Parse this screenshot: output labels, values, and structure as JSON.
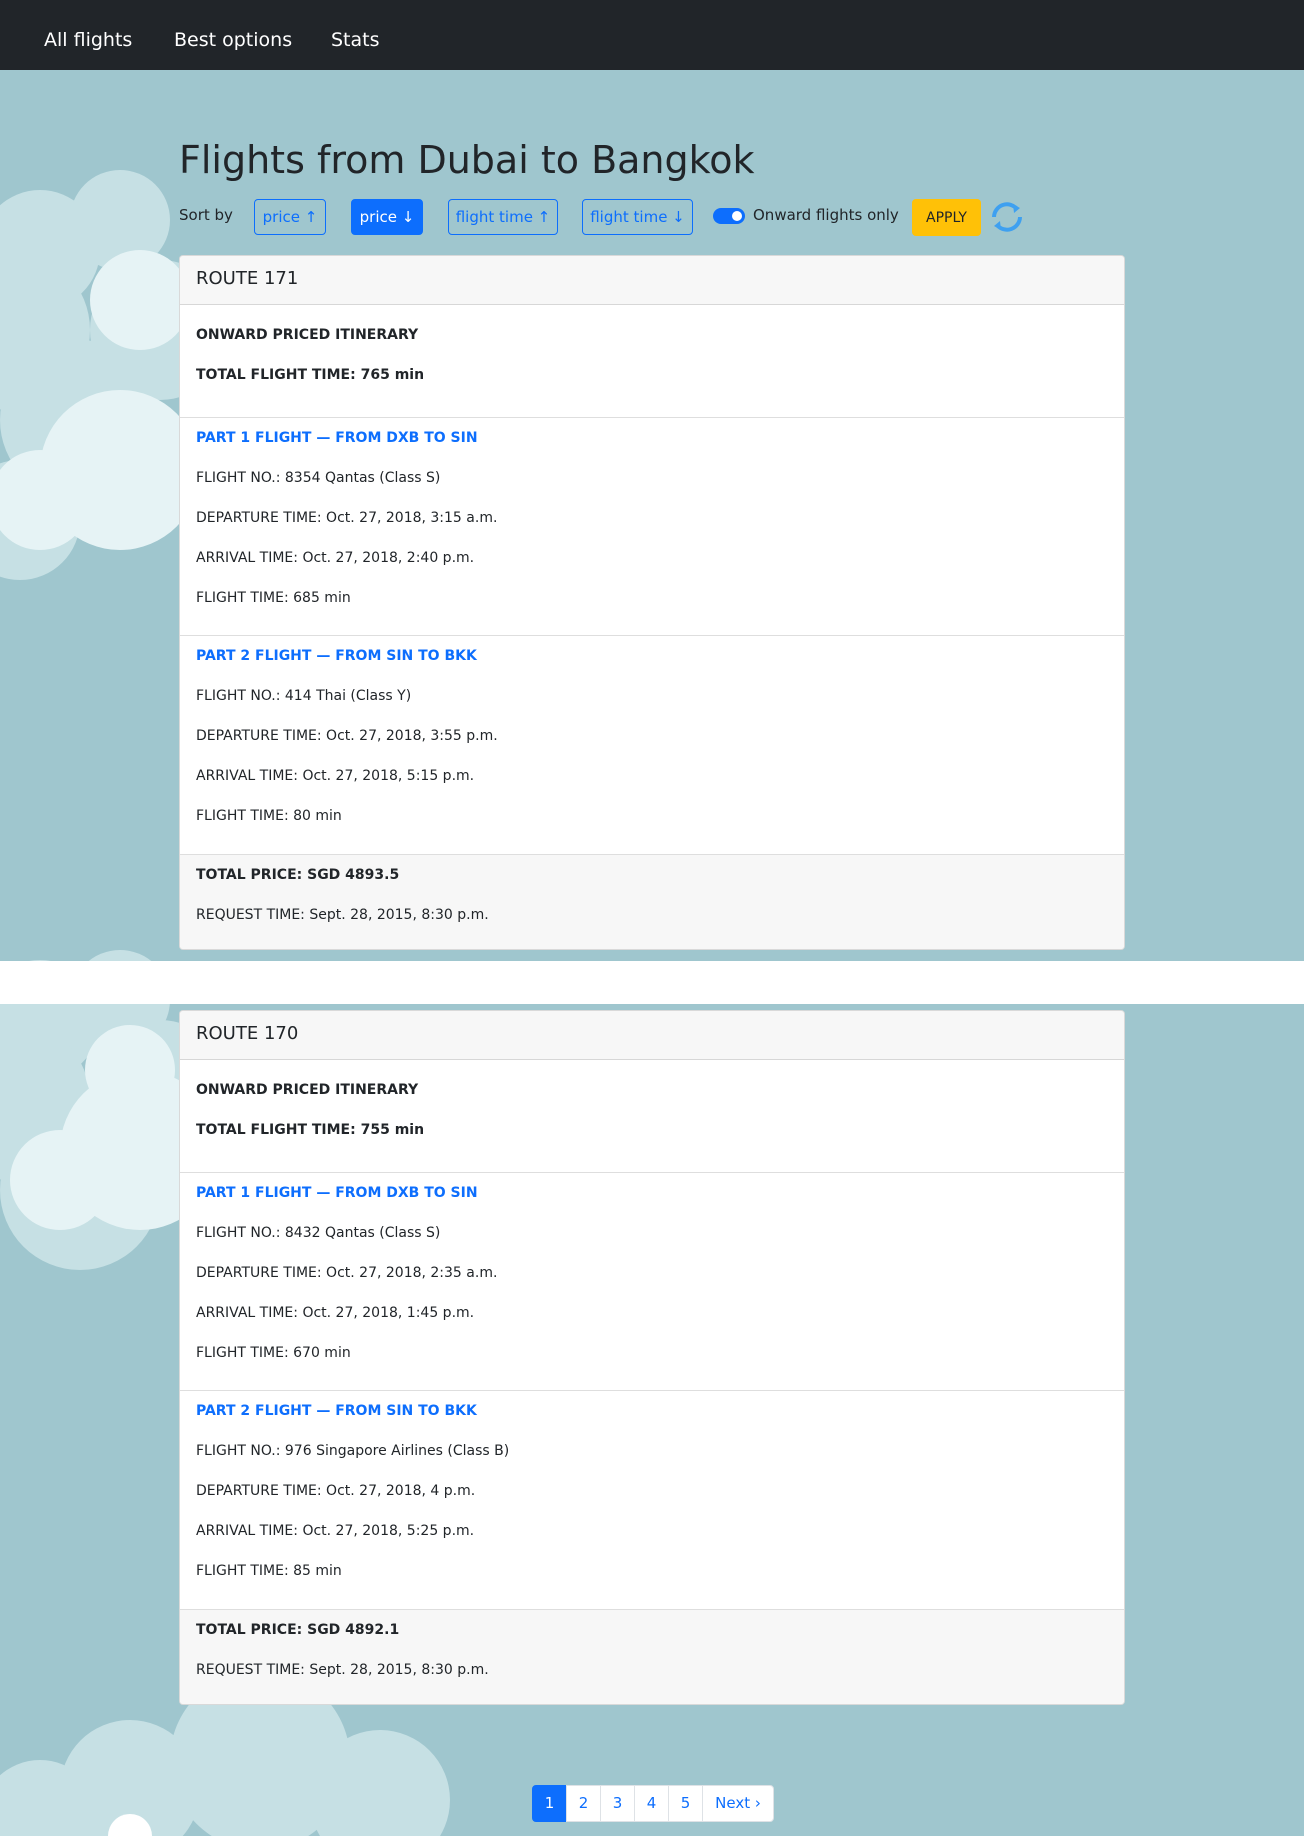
{
  "nav": {
    "items": [
      {
        "label": "All flights"
      },
      {
        "label": "Best options"
      },
      {
        "label": "Stats"
      }
    ]
  },
  "page_title": "Flights from Dubai to Bangkok",
  "controls": {
    "sort_label": "Sort by",
    "sort_buttons": [
      {
        "label": "price ↑",
        "active": false
      },
      {
        "label": "price ↓",
        "active": true
      },
      {
        "label": "flight time ↑",
        "active": false
      },
      {
        "label": "flight time ↓",
        "active": false
      }
    ],
    "onward_toggle": {
      "label": "Onward flights only",
      "checked": true
    },
    "apply_label": "APPLY",
    "refresh_icon": "refresh-icon"
  },
  "routes": [
    {
      "title": "ROUTE 171",
      "itinerary_type": "ONWARD PRICED ITINERARY",
      "total_flight_time": "TOTAL FLIGHT TIME: 765 min",
      "parts": [
        {
          "heading": "PART 1 FLIGHT — FROM DXB TO SIN",
          "flight_no": "FLIGHT NO.: 8354 Qantas (Class S)",
          "departure": "DEPARTURE TIME: Oct. 27, 2018, 3:15 a.m.",
          "arrival": "ARRIVAL TIME: Oct. 27, 2018, 2:40 p.m.",
          "flight_time": "FLIGHT TIME: 685 min"
        },
        {
          "heading": "PART 2 FLIGHT — FROM SIN TO BKK",
          "flight_no": "FLIGHT NO.: 414 Thai (Class Y)",
          "departure": "DEPARTURE TIME: Oct. 27, 2018, 3:55 p.m.",
          "arrival": "ARRIVAL TIME: Oct. 27, 2018, 5:15 p.m.",
          "flight_time": "FLIGHT TIME: 80 min"
        }
      ],
      "total_price": "TOTAL PRICE: SGD 4893.5",
      "request_time": "REQUEST TIME: Sept. 28, 2015, 8:30 p.m."
    },
    {
      "title": "ROUTE 170",
      "itinerary_type": "ONWARD PRICED ITINERARY",
      "total_flight_time": "TOTAL FLIGHT TIME: 755 min",
      "parts": [
        {
          "heading": "PART 1 FLIGHT — FROM DXB TO SIN",
          "flight_no": "FLIGHT NO.: 8432 Qantas (Class S)",
          "departure": "DEPARTURE TIME: Oct. 27, 2018, 2:35 a.m.",
          "arrival": "ARRIVAL TIME: Oct. 27, 2018, 1:45 p.m.",
          "flight_time": "FLIGHT TIME: 670 min"
        },
        {
          "heading": "PART 2 FLIGHT — FROM SIN TO BKK",
          "flight_no": "FLIGHT NO.: 976 Singapore Airlines (Class B)",
          "departure": "DEPARTURE TIME: Oct. 27, 2018, 4 p.m.",
          "arrival": "ARRIVAL TIME: Oct. 27, 2018, 5:25 p.m.",
          "flight_time": "FLIGHT TIME: 85 min"
        }
      ],
      "total_price": "TOTAL PRICE: SGD 4892.1",
      "request_time": "REQUEST TIME: Sept. 28, 2015, 8:30 p.m."
    }
  ],
  "pagination": {
    "pages": [
      "1",
      "2",
      "3",
      "4",
      "5"
    ],
    "current": "1",
    "next_label": "Next ›"
  },
  "colors": {
    "navbar_bg": "#212529",
    "background": "#9fc6ce",
    "primary": "#0d6efd",
    "apply_bg": "#ffc107"
  }
}
